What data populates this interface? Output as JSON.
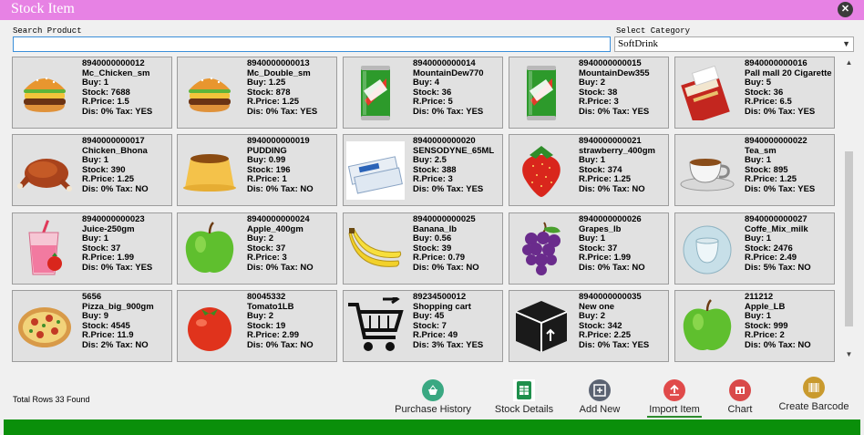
{
  "window": {
    "title": "Stock Item",
    "close_label": "✕"
  },
  "search": {
    "label": "Search Product",
    "value": "",
    "placeholder": ""
  },
  "category": {
    "label": "Select Category",
    "selected": "SoftDrink"
  },
  "products": [
    {
      "code": "8940000000012",
      "name": "Mc_Chicken_sm",
      "buy": "Buy: 1",
      "stock": "Stock: 7688",
      "rprice": "R.Price: 1.5",
      "distax": "Dis: 0% Tax: YES",
      "icon": "burger-icon"
    },
    {
      "code": "8940000000013",
      "name": "Mc_Double_sm",
      "buy": "Buy: 1.25",
      "stock": "Stock: 878",
      "rprice": "R.Price: 1.25",
      "distax": "Dis: 0% Tax: YES",
      "icon": "burger-icon"
    },
    {
      "code": "8940000000014",
      "name": "MountainDew770",
      "buy": "Buy: 4",
      "stock": "Stock: 36",
      "rprice": "R.Price: 5",
      "distax": "Dis: 0% Tax: YES",
      "icon": "soda-can-icon"
    },
    {
      "code": "8940000000015",
      "name": "MountainDew355",
      "buy": "Buy: 2",
      "stock": "Stock: 38",
      "rprice": "R.Price: 3",
      "distax": "Dis: 0% Tax: YES",
      "icon": "soda-can-icon"
    },
    {
      "code": "8940000000016",
      "name": "Pall mall 20 Cigarette",
      "buy": "Buy: 5",
      "stock": "Stock: 36",
      "rprice": "R.Price: 6.5",
      "distax": "Dis: 0% Tax: YES",
      "icon": "cigarette-pack-icon"
    },
    {
      "code": "8940000000017",
      "name": "Chicken_Bhona",
      "buy": "Buy: 1",
      "stock": "Stock: 390",
      "rprice": "R.Price: 1.25",
      "distax": "Dis: 0% Tax: NO",
      "icon": "roast-chicken-icon"
    },
    {
      "code": "8940000000019",
      "name": "PUDDING",
      "buy": "Buy: 0.99",
      "stock": "Stock: 196",
      "rprice": "R.Price: 1",
      "distax": "Dis: 0% Tax: NO",
      "icon": "pudding-icon"
    },
    {
      "code": "8940000000020",
      "name": "SENSODYNE_65ML",
      "buy": "Buy: 2.5",
      "stock": "Stock: 388",
      "rprice": "R.Price: 3",
      "distax": "Dis: 0% Tax: YES",
      "icon": "toothpaste-icon"
    },
    {
      "code": "8940000000021",
      "name": "strawberry_400gm",
      "buy": "Buy: 1",
      "stock": "Stock: 374",
      "rprice": "R.Price: 1.25",
      "distax": "Dis: 0% Tax: NO",
      "icon": "strawberry-icon"
    },
    {
      "code": "8940000000022",
      "name": "Tea_sm",
      "buy": "Buy: 1",
      "stock": "Stock: 895",
      "rprice": "R.Price: 1.25",
      "distax": "Dis: 0% Tax: YES",
      "icon": "tea-cup-icon"
    },
    {
      "code": "8940000000023",
      "name": "Juice-250gm",
      "buy": "Buy: 1",
      "stock": "Stock: 37",
      "rprice": "R.Price: 1.99",
      "distax": "Dis: 0% Tax: YES",
      "icon": "juice-cup-icon"
    },
    {
      "code": "8940000000024",
      "name": "Apple_400gm",
      "buy": "Buy: 2",
      "stock": "Stock: 37",
      "rprice": "R.Price: 3",
      "distax": "Dis: 0% Tax: NO",
      "icon": "green-apple-icon"
    },
    {
      "code": "8940000000025",
      "name": "Banana_lb",
      "buy": "Buy: 0.56",
      "stock": "Stock: 39",
      "rprice": "R.Price: 0.79",
      "distax": "Dis: 0% Tax: NO",
      "icon": "banana-icon"
    },
    {
      "code": "8940000000026",
      "name": "Grapes_lb",
      "buy": "Buy: 1",
      "stock": "Stock: 37",
      "rprice": "R.Price: 1.99",
      "distax": "Dis: 0% Tax: NO",
      "icon": "grapes-icon"
    },
    {
      "code": "8940000000027",
      "name": "Coffe_Mix_milk",
      "buy": "Buy: 1",
      "stock": "Stock: 2476",
      "rprice": "R.Price: 2.49",
      "distax": "Dis: 5% Tax: NO",
      "icon": "coffee-cup-icon"
    },
    {
      "code": "5656",
      "name": "Pizza_big_900gm",
      "buy": "Buy: 9",
      "stock": "Stock: 4545",
      "rprice": "R.Price: 11.9",
      "distax": "Dis: 2% Tax: NO",
      "icon": "pizza-icon"
    },
    {
      "code": "80045332",
      "name": "Tomato1LB",
      "buy": "Buy: 2",
      "stock": "Stock: 19",
      "rprice": "R.Price: 2.99",
      "distax": "Dis: 0% Tax: NO",
      "icon": "tomato-icon"
    },
    {
      "code": "89234500012",
      "name": "Shopping cart",
      "buy": "Buy: 45",
      "stock": "Stock: 7",
      "rprice": "R.Price: 49",
      "distax": "Dis: 3% Tax: YES",
      "icon": "shopping-cart-icon"
    },
    {
      "code": "8940000000035",
      "name": "New one",
      "buy": "Buy: 2",
      "stock": "Stock: 342",
      "rprice": "R.Price: 2.25",
      "distax": "Dis: 0% Tax: YES",
      "icon": "box-icon"
    },
    {
      "code": "211212",
      "name": "Apple_LB",
      "buy": "Buy: 1",
      "stock": "Stock: 999",
      "rprice": "R.Price: 2",
      "distax": "Dis: 0% Tax: NO",
      "icon": "green-apple-icon"
    }
  ],
  "status": {
    "total_rows": "Total Rows 33 Found"
  },
  "toolbar": [
    {
      "name": "purchase-history-button",
      "label": "Purchase History",
      "icon": "basket-icon",
      "color": "#3aa882",
      "underline": ""
    },
    {
      "name": "stock-details-button",
      "label": "Stock Details",
      "icon": "spreadsheet-icon",
      "color": "#ffffff",
      "underline": ""
    },
    {
      "name": "add-new-button",
      "label": "Add New",
      "icon": "plus-square-icon",
      "color": "#5b6372",
      "underline": ""
    },
    {
      "name": "import-item-button",
      "label": "Import Item",
      "icon": "upload-icon",
      "color": "#e04a4a",
      "underline": "#2d8c2d"
    },
    {
      "name": "chart-button",
      "label": "Chart",
      "icon": "chart-icon",
      "color": "#d94a4a",
      "underline": ""
    },
    {
      "name": "create-barcode-button",
      "label": "Create Barcode",
      "icon": "barcode-icon",
      "color": "#c99a2e",
      "underline": ""
    }
  ],
  "colors": {
    "titlebar": "#e782e4",
    "footer": "#0a8f0a",
    "card_bg": "#e1e1e1"
  }
}
